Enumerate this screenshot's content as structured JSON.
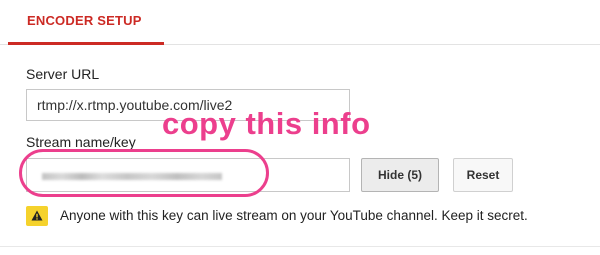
{
  "tab": {
    "label": "ENCODER SETUP"
  },
  "server": {
    "label": "Server URL",
    "value": "rtmp://x.rtmp.youtube.com/live2"
  },
  "stream": {
    "label": "Stream name/key",
    "value_masked": true
  },
  "annotation": {
    "text": "copy this info",
    "color": "#ec3f8d"
  },
  "buttons": {
    "hide": "Hide (5)",
    "reset": "Reset"
  },
  "warning": {
    "icon": "warning-icon",
    "text": "Anyone with this key can live stream on your YouTube channel. Keep it secret."
  },
  "colors": {
    "accent": "#cc2a24",
    "warning_bg": "#f5d22c",
    "highlight": "#ec3f8d"
  }
}
